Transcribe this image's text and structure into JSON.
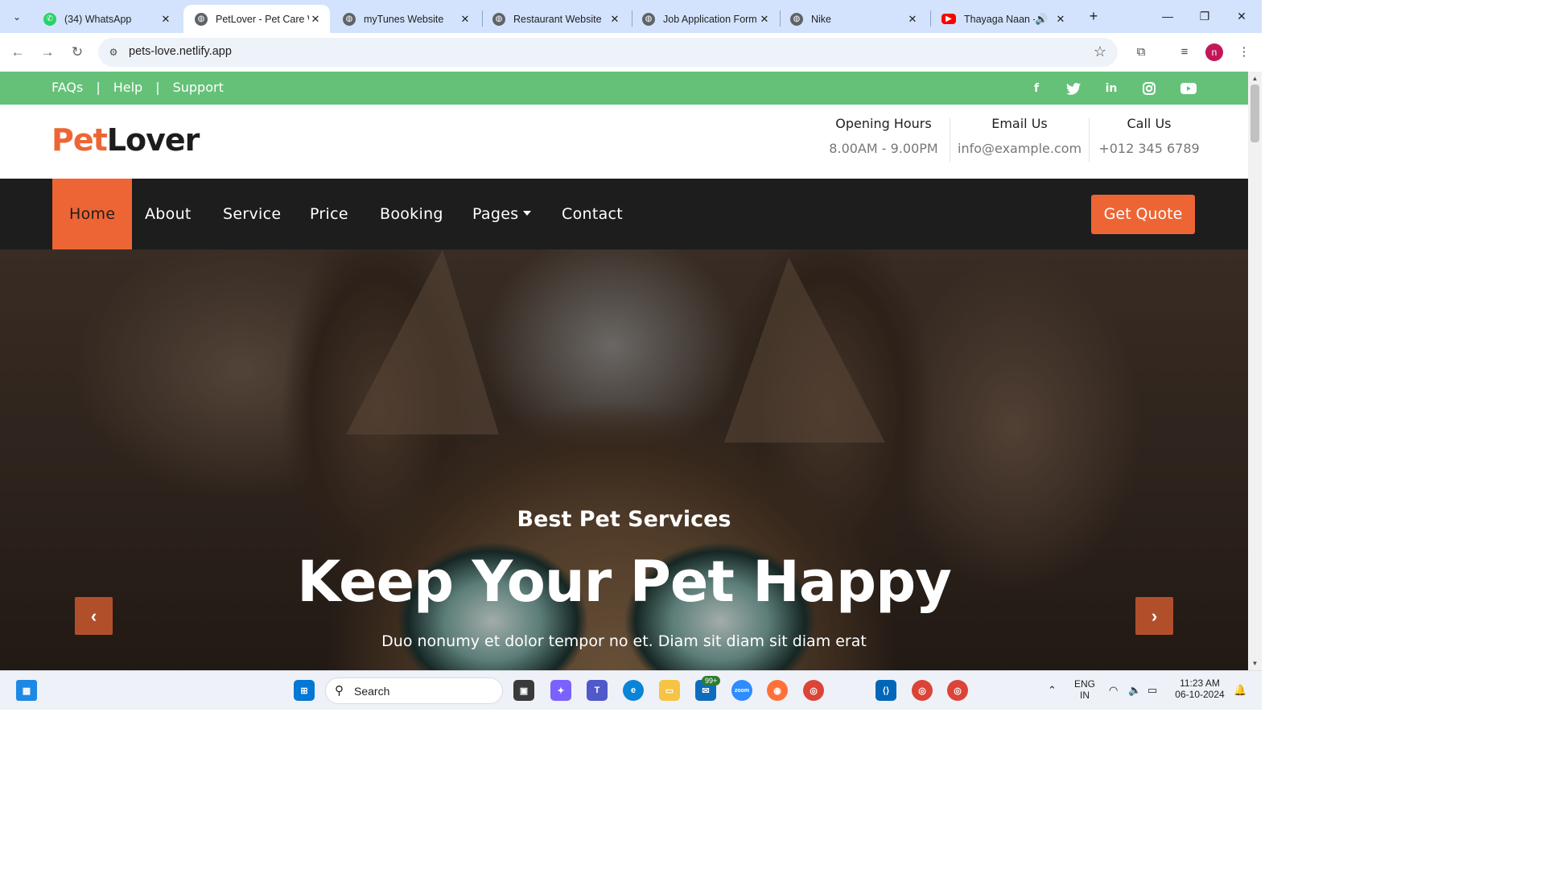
{
  "browser": {
    "tabs": [
      {
        "title": "(34) WhatsApp",
        "icon": "whatsapp-icon",
        "active": false
      },
      {
        "title": "PetLover - Pet Care W",
        "icon": "globe-icon",
        "active": true
      },
      {
        "title": "myTunes Website",
        "icon": "globe-icon",
        "active": false
      },
      {
        "title": "Restaurant Website",
        "icon": "globe-icon",
        "active": false
      },
      {
        "title": "Job Application Form",
        "icon": "globe-icon",
        "active": false
      },
      {
        "title": "Nike",
        "icon": "globe-icon",
        "active": false
      },
      {
        "title": "Thayaga Naan - Y",
        "icon": "youtube-icon",
        "active": false
      }
    ],
    "url": "pets-love.netlify.app",
    "profile_initial": "n"
  },
  "site": {
    "top_links": [
      "FAQs",
      "Help",
      "Support"
    ],
    "top_sep": "|",
    "social_icons": [
      "facebook-icon",
      "twitter-icon",
      "linkedin-icon",
      "instagram-icon",
      "youtube-icon"
    ],
    "logo": {
      "part1": "Pet",
      "part2": "Lover"
    },
    "info": [
      {
        "heading": "Opening Hours",
        "value": "8.00AM - 9.00PM"
      },
      {
        "heading": "Email Us",
        "value": "info@example.com"
      },
      {
        "heading": "Call Us",
        "value": "+012 345 6789"
      }
    ],
    "nav": [
      "Home",
      "About",
      "Service",
      "Price",
      "Booking",
      "Pages",
      "Contact"
    ],
    "nav_active": "Home",
    "quote_button": "Get Quote",
    "hero": {
      "subtitle": "Best Pet Services",
      "title": "Keep Your Pet Happy",
      "description": "Duo nonumy et dolor tempor no et. Diam sit diam sit diam erat"
    },
    "colors": {
      "accent": "#ee6535",
      "topbar": "#65c178",
      "nav": "#1d1d1d"
    }
  },
  "taskbar": {
    "search_label": "Search",
    "mail_badge": "99+",
    "lang_line1": "ENG",
    "lang_line2": "IN",
    "time": "11:23 AM",
    "date": "06-10-2024"
  }
}
